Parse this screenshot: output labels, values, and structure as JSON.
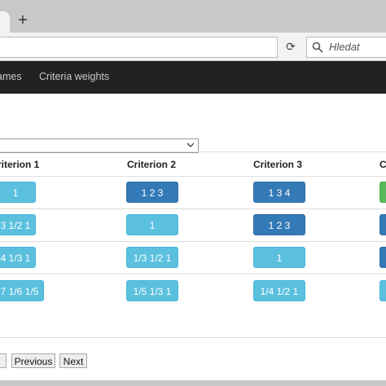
{
  "browser": {
    "new_tab_label": "+",
    "reload_icon": "⟳",
    "search_placeholder": "Hledat"
  },
  "navbar": {
    "items": [
      "ames",
      "Criteria weights"
    ]
  },
  "table": {
    "headers": [
      "riterion 1",
      "Criterion 2",
      "Criterion 3",
      "C"
    ],
    "rows": [
      [
        "1",
        "1 2 3",
        "1 3 4"
      ],
      [
        "3 1/2 1",
        "1",
        "1 2 3"
      ],
      [
        "4 1/3 1",
        "1/3 1/2 1",
        "1"
      ],
      [
        "7 1/6 1/5",
        "1/5 1/3 1",
        "1/4 1/2 1"
      ]
    ]
  },
  "pagination": {
    "previous": "Previous",
    "next": "Next"
  },
  "colors": {
    "light_button": "#5bc0de",
    "dark_button": "#337ab7",
    "green_button": "#5cb85c",
    "navbar_bg": "#222222"
  }
}
